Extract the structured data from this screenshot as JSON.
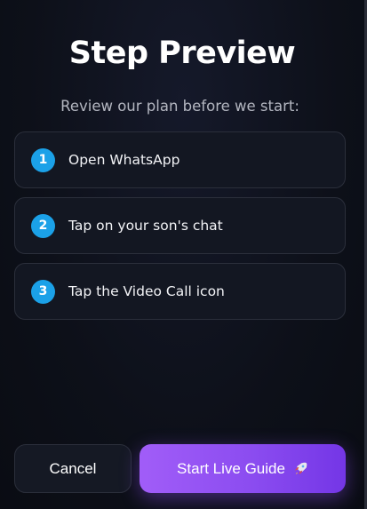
{
  "header": {
    "title": "Step Preview",
    "subtitle": "Review our plan before we start:"
  },
  "steps": [
    {
      "number": "1",
      "label": "Open WhatsApp"
    },
    {
      "number": "2",
      "label": "Tap on your son's chat"
    },
    {
      "number": "3",
      "label": "Tap the Video Call icon"
    }
  ],
  "footer": {
    "cancel_label": "Cancel",
    "start_label": "Start Live Guide",
    "start_icon": "rocket-icon"
  },
  "colors": {
    "step_badge": "#1ba1e8",
    "primary_gradient_start": "#a15df8",
    "primary_gradient_end": "#7436e6",
    "background": "#0d1019"
  }
}
